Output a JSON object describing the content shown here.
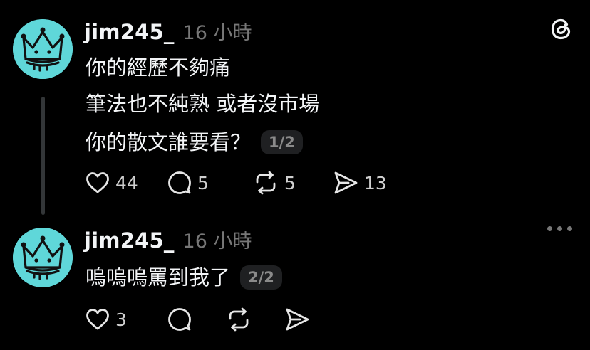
{
  "post1": {
    "username": "jim245_",
    "time": "16 小時",
    "lines": [
      "你的經歷不夠痛",
      "筆法也不純熟 或者沒市場",
      "你的散文誰要看？"
    ],
    "page": "1/2",
    "likes": "44",
    "replies": "5",
    "reposts": "5",
    "shares": "13"
  },
  "post2": {
    "username": "jim245_",
    "time": "16 小時",
    "lines": [
      "嗚嗚嗚罵到我了"
    ],
    "page": "2/2",
    "likes": "3"
  },
  "icons": {
    "app_logo": "threads-logo-icon",
    "more": "more-horizontal-icon",
    "like": "heart-icon",
    "reply": "comment-bubble-icon",
    "repost": "repost-icon",
    "share": "send-icon"
  },
  "colors": {
    "background": "#000000",
    "text": "#f3f5f7",
    "muted": "#777777",
    "avatar": "#5fd7d9"
  }
}
